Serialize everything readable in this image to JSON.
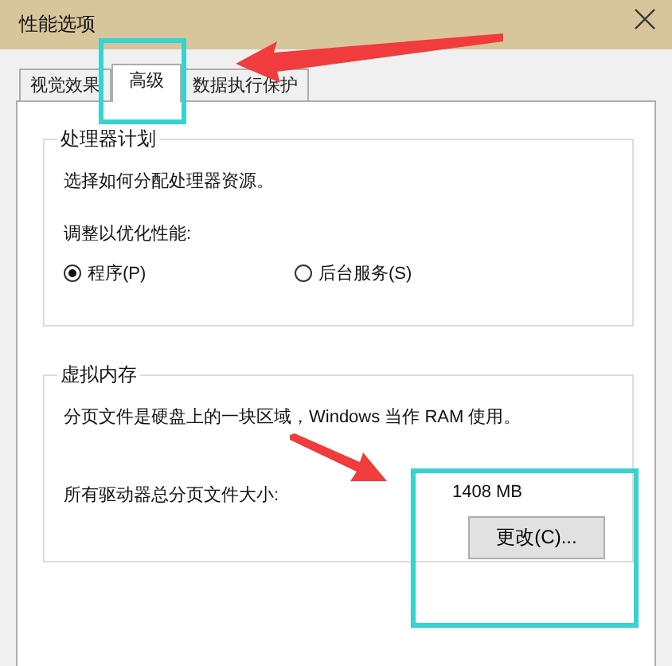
{
  "window": {
    "title": "性能选项"
  },
  "tabs": [
    {
      "label": "视觉效果",
      "selected": false
    },
    {
      "label": "高级",
      "selected": true
    },
    {
      "label": "数据执行保护",
      "selected": false
    }
  ],
  "processor_scheduling": {
    "title": "处理器计划",
    "description": "选择如何分配处理器资源。",
    "prompt": "调整以优化性能:",
    "options": [
      {
        "label": "程序(P)",
        "selected": true
      },
      {
        "label": "后台服务(S)",
        "selected": false
      }
    ]
  },
  "virtual_memory": {
    "title": "虚拟内存",
    "description": "分页文件是硬盘上的一块区域，Windows 当作 RAM 使用。",
    "size_label": "所有驱动器总分页文件大小:",
    "size_value": "1408 MB",
    "change_button": "更改(C)..."
  }
}
